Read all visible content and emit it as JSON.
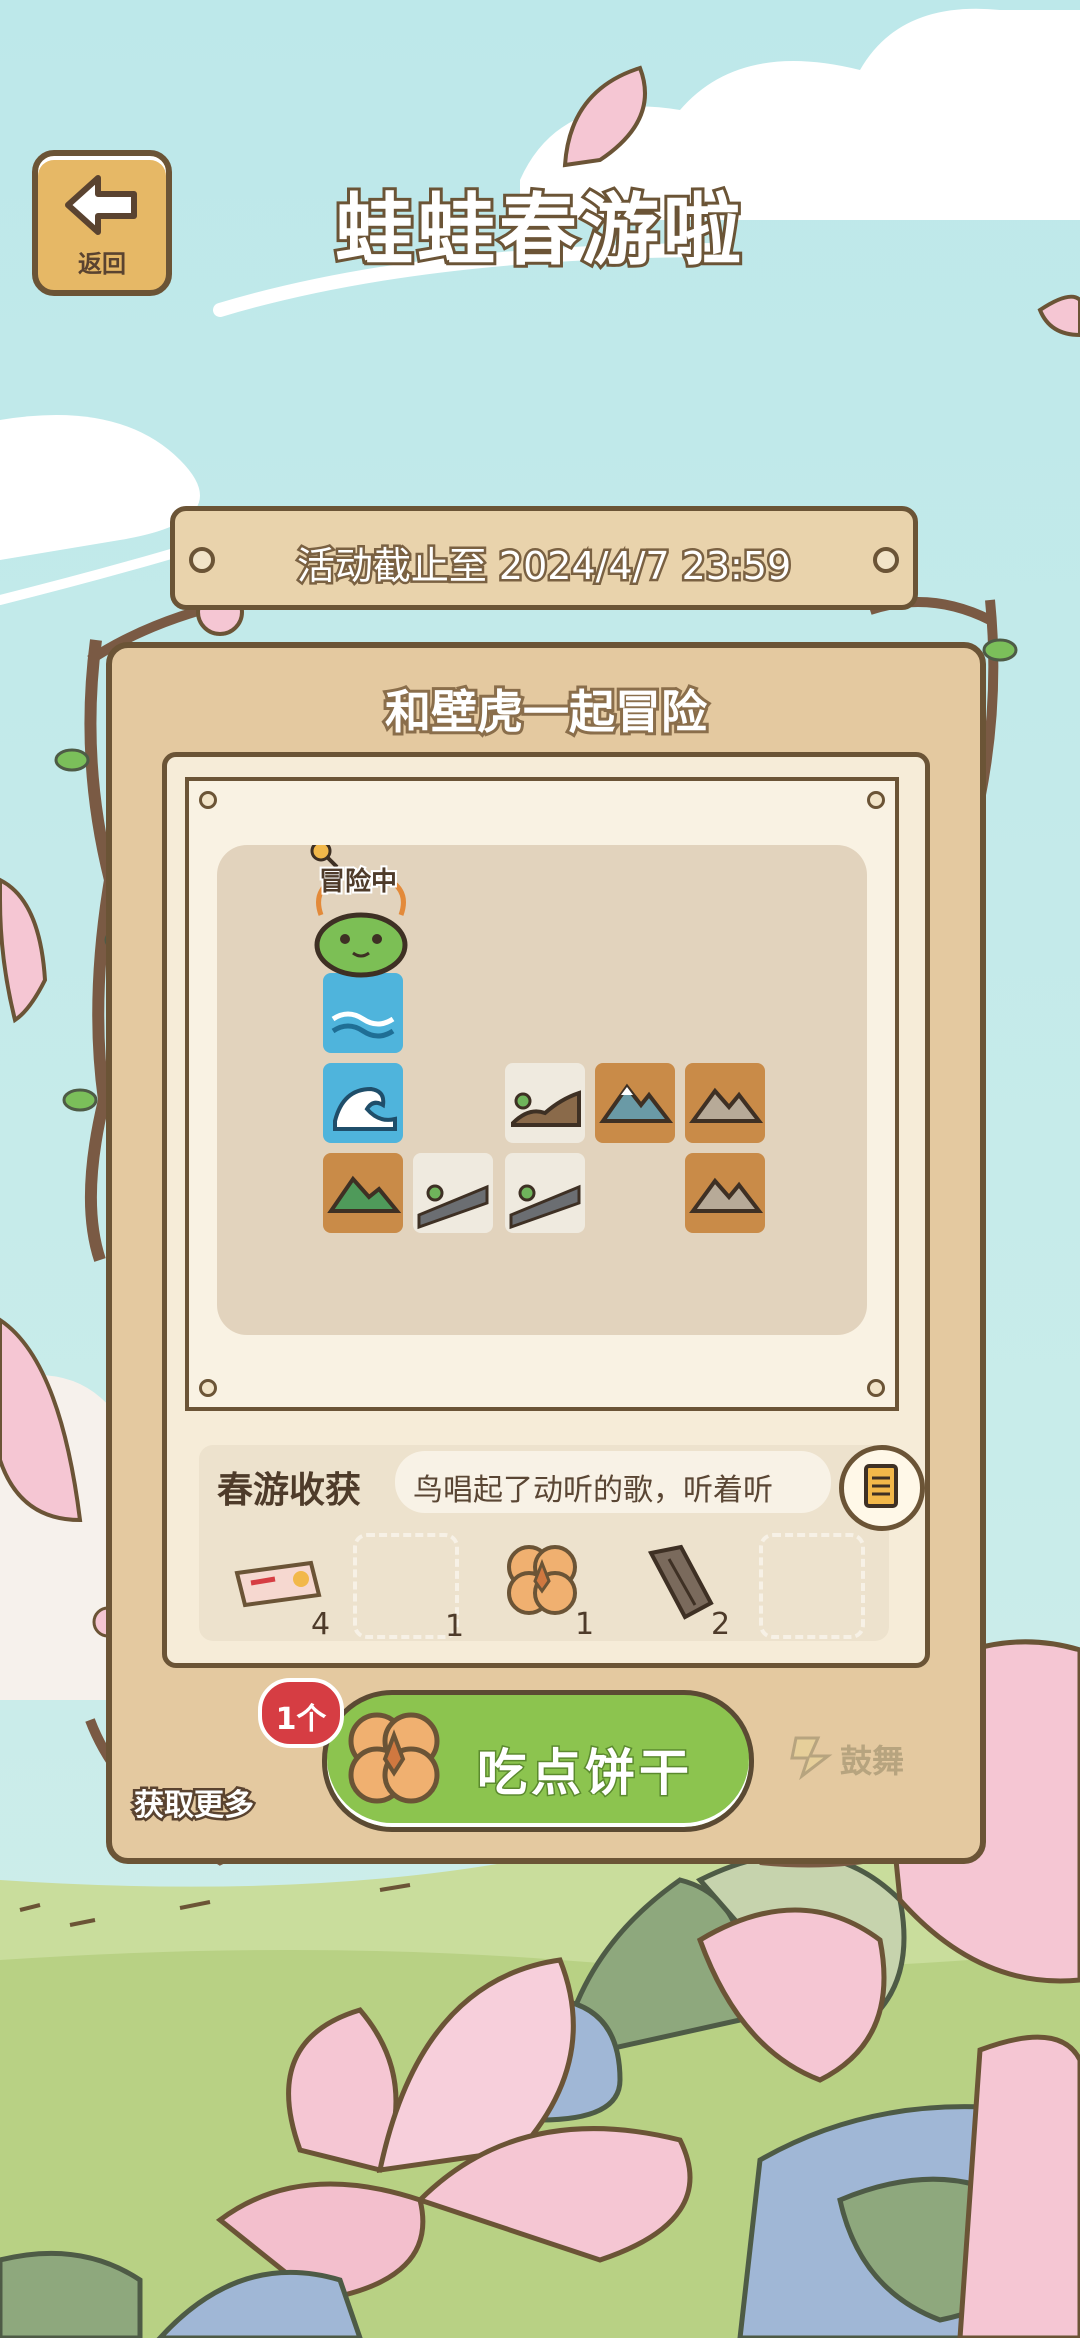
{
  "header": {
    "title": "蛙蛙春游啦",
    "back_label": "返回"
  },
  "event": {
    "deadline": "活动截止至 2024/4/7 23:59"
  },
  "board": {
    "title": "和壁虎一起冒险",
    "status_tag": "冒险中"
  },
  "harvest": {
    "label": "春游收获",
    "message": "鸟唱起了动听的歌，听着听",
    "items": [
      {
        "icon": "ticket-icon",
        "count": "4"
      },
      {
        "icon": "empty-slot",
        "count": "1"
      },
      {
        "icon": "biscuit-icon",
        "count": "1"
      },
      {
        "icon": "bark-icon",
        "count": "2"
      },
      {
        "icon": "empty-slot",
        "count": ""
      }
    ]
  },
  "actions": {
    "eat_badge": "1个",
    "eat_label": "吃点饼干",
    "get_more": "获取更多",
    "drum_label": "鼓舞"
  },
  "colors": {
    "sky": "#bfe9ea",
    "wood": "#e4c9a0",
    "outline": "#6b5436",
    "green_button": "#8cc44f",
    "badge_red": "#d63d43",
    "petal_pink": "#f5c6d3"
  }
}
